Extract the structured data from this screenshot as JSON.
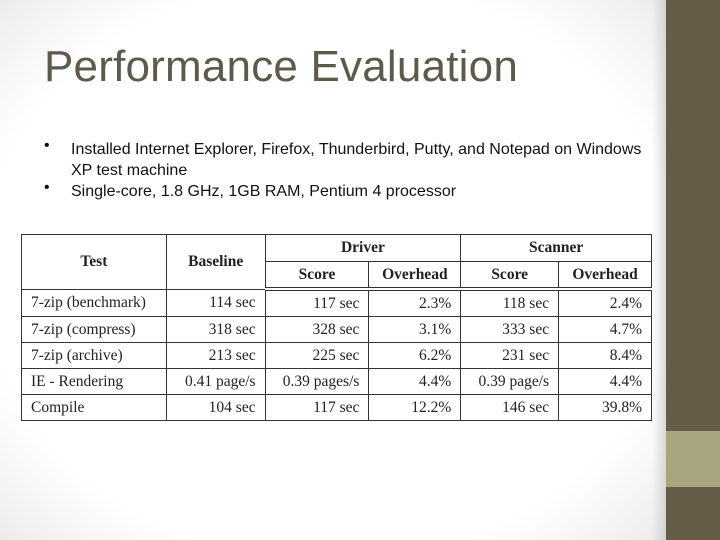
{
  "slide": {
    "title": "Performance Evaluation",
    "bullets": [
      "Installed Internet Explorer, Firefox, Thunderbird, Putty, and Notepad on Windows XP test machine",
      "Single-core, 1.8 GHz, 1GB RAM, Pentium 4 processor"
    ],
    "bullet_glyph": "•",
    "theme_colors": {
      "title": "#5e5a4a",
      "side_band": "#655d48",
      "side_accent": "#a9a57f"
    }
  },
  "table": {
    "headers": {
      "test": "Test",
      "baseline": "Baseline",
      "driver": "Driver",
      "scanner": "Scanner",
      "driver_score": "Score",
      "driver_overhead": "Overhead",
      "scanner_score": "Score",
      "scanner_overhead": "Overhead"
    },
    "rows": [
      {
        "test": "7-zip (benchmark)",
        "baseline": "114 sec",
        "driver_score": "117 sec",
        "driver_overhead": "2.3%",
        "scanner_score": "118 sec",
        "scanner_overhead": "2.4%"
      },
      {
        "test": "7-zip (compress)",
        "baseline": "318 sec",
        "driver_score": "328 sec",
        "driver_overhead": "3.1%",
        "scanner_score": "333 sec",
        "scanner_overhead": "4.7%"
      },
      {
        "test": "7-zip (archive)",
        "baseline": "213 sec",
        "driver_score": "225 sec",
        "driver_overhead": "6.2%",
        "scanner_score": "231 sec",
        "scanner_overhead": "8.4%"
      },
      {
        "test": "IE - Rendering",
        "baseline": "0.41 page/s",
        "driver_score": "0.39 pages/s",
        "driver_overhead": "4.4%",
        "scanner_score": "0.39 page/s",
        "scanner_overhead": "4.4%"
      },
      {
        "test": "Compile",
        "baseline": "104 sec",
        "driver_score": "117 sec",
        "driver_overhead": "12.2%",
        "scanner_score": "146 sec",
        "scanner_overhead": "39.8%"
      }
    ]
  }
}
